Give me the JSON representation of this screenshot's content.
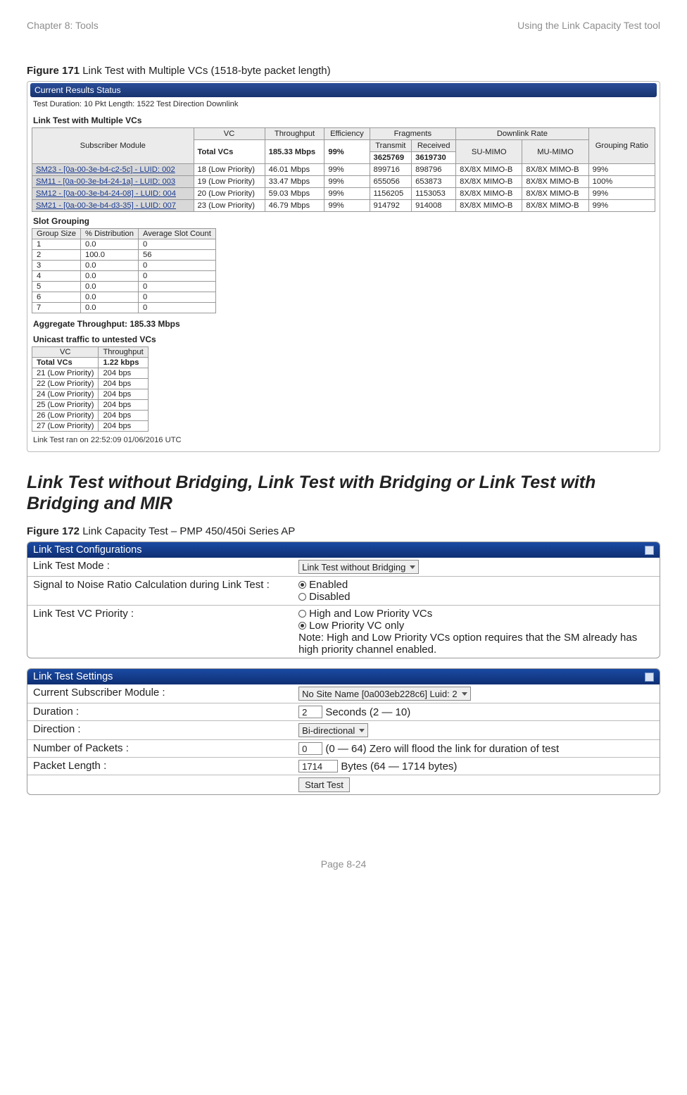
{
  "header": {
    "left": "Chapter 8:  Tools",
    "right": "Using the Link Capacity Test tool"
  },
  "fig171": {
    "label_bold": "Figure 171",
    "label_rest": " Link Test with Multiple VCs (1518-byte packet length)",
    "banner": "Current Results Status",
    "meta": "Test Duration: 10   Pkt Length: 1522   Test Direction Downlink",
    "subhead": "Link Test with Multiple VCs",
    "main_headers": {
      "sm": "Subscriber Module",
      "vc": "VC",
      "thr": "Throughput",
      "eff": "Efficiency",
      "frag": "Fragments",
      "tx": "Transmit",
      "rx": "Received",
      "dlr": "Downlink Rate",
      "su": "SU-MIMO",
      "mu": "MU-MIMO",
      "grp": "Grouping Ratio"
    },
    "totals": {
      "label": "Total VCs",
      "thr": "185.33 Mbps",
      "eff": "99%",
      "tx": "3625769",
      "rx": "3619730"
    },
    "rows": [
      {
        "sm": "SM23 - [0a-00-3e-b4-c2-5c] - LUID: 002",
        "vc": "18 (Low Priority)",
        "thr": "46.01 Mbps",
        "eff": "99%",
        "tx": "899716",
        "rx": "898796",
        "su": "8X/8X MIMO-B",
        "mu": "8X/8X MIMO-B",
        "grp": "99%"
      },
      {
        "sm": "SM11 - [0a-00-3e-b4-24-1a] - LUID: 003",
        "vc": "19 (Low Priority)",
        "thr": "33.47 Mbps",
        "eff": "99%",
        "tx": "655056",
        "rx": "653873",
        "su": "8X/8X MIMO-B",
        "mu": "8X/8X MIMO-B",
        "grp": "100%"
      },
      {
        "sm": "SM12 - [0a-00-3e-b4-24-08] - LUID: 004",
        "vc": "20 (Low Priority)",
        "thr": "59.03 Mbps",
        "eff": "99%",
        "tx": "1156205",
        "rx": "1153053",
        "su": "8X/8X MIMO-B",
        "mu": "8X/8X MIMO-B",
        "grp": "99%"
      },
      {
        "sm": "SM21 - [0a-00-3e-b4-d3-35] - LUID: 007",
        "vc": "23 (Low Priority)",
        "thr": "46.79 Mbps",
        "eff": "99%",
        "tx": "914792",
        "rx": "914008",
        "su": "8X/8X MIMO-B",
        "mu": "8X/8X MIMO-B",
        "grp": "99%"
      }
    ],
    "slot_head": "Slot Grouping",
    "slot_headers": {
      "gs": "Group Size",
      "dist": "% Distribution",
      "avg": "Average Slot Count"
    },
    "slot_rows": [
      {
        "gs": "1",
        "dist": "0.0",
        "avg": "0"
      },
      {
        "gs": "2",
        "dist": "100.0",
        "avg": "56"
      },
      {
        "gs": "3",
        "dist": "0.0",
        "avg": "0"
      },
      {
        "gs": "4",
        "dist": "0.0",
        "avg": "0"
      },
      {
        "gs": "5",
        "dist": "0.0",
        "avg": "0"
      },
      {
        "gs": "6",
        "dist": "0.0",
        "avg": "0"
      },
      {
        "gs": "7",
        "dist": "0.0",
        "avg": "0"
      }
    ],
    "aggregate": "Aggregate Throughput: 185.33 Mbps",
    "unicast_head": "Unicast traffic to untested VCs",
    "vc_headers": {
      "vc": "VC",
      "thr": "Throughput"
    },
    "vc_total": {
      "label": "Total VCs",
      "val": "1.22 kbps"
    },
    "vc_rows": [
      {
        "vc": "21 (Low Priority)",
        "thr": "204 bps"
      },
      {
        "vc": "22 (Low Priority)",
        "thr": "204 bps"
      },
      {
        "vc": "24 (Low Priority)",
        "thr": "204 bps"
      },
      {
        "vc": "25 (Low Priority)",
        "thr": "204 bps"
      },
      {
        "vc": "26 (Low Priority)",
        "thr": "204 bps"
      },
      {
        "vc": "27 (Low Priority)",
        "thr": "204 bps"
      }
    ],
    "timestamp": "Link Test ran on 22:52:09 01/06/2016 UTC"
  },
  "section_title": "Link Test without Bridging, Link Test with Bridging or Link Test with Bridging and MIR",
  "fig172": {
    "label_bold": "Figure 172",
    "label_rest": " Link Capacity Test – PMP 450/450i Series AP",
    "cfg_title": "Link Test Configurations",
    "settings_title": "Link Test Settings",
    "rows": {
      "mode_label": "Link Test Mode :",
      "mode_value": "Link Test without Bridging",
      "snr_label": "Signal to Noise Ratio Calculation during Link Test :",
      "snr_enabled": "Enabled",
      "snr_disabled": "Disabled",
      "vcp_label": "Link Test VC Priority :",
      "vcp_opt1": "High and Low Priority VCs",
      "vcp_opt2": "Low Priority VC only",
      "vcp_note": "Note: High and Low Priority VCs option requires that the SM already has high priority channel enabled.",
      "csm_label": "Current Subscriber Module :",
      "csm_value": "No Site Name [0a003eb228c6] Luid: 2",
      "dur_label": "Duration :",
      "dur_value": "2",
      "dur_suffix": "Seconds (2 — 10)",
      "dir_label": "Direction :",
      "dir_value": "Bi-directional",
      "np_label": "Number of Packets :",
      "np_value": "0",
      "np_suffix": "(0 — 64) Zero will flood the link for duration of test",
      "pl_label": "Packet Length :",
      "pl_value": "1714",
      "pl_suffix": "Bytes (64 — 1714 bytes)",
      "start": "Start Test"
    }
  },
  "footer": "Page 8-24"
}
